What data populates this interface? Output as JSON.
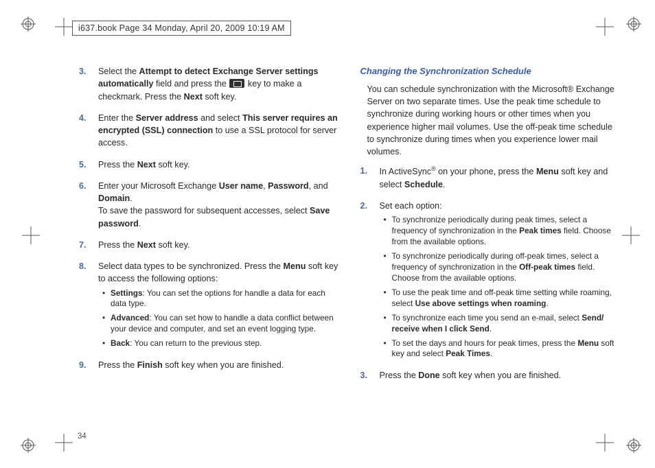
{
  "header": {
    "text": "i637.book  Page 34  Monday, April 20, 2009  10:19 AM"
  },
  "page_number": "34",
  "left_column": {
    "steps": [
      {
        "num": "3.",
        "html": "Select the <b>Attempt to detect Exchange Server settings automatically</b> field and press the {KEY} key to make a checkmark. Press the <b>Next</b> soft key."
      },
      {
        "num": "4.",
        "html": "Enter the <b>Server address</b> and select <b>This server requires an encrypted (SSL) connection</b> to use a SSL protocol for server access."
      },
      {
        "num": "5.",
        "html": "Press the <b>Next</b> soft key."
      },
      {
        "num": "6.",
        "html": "Enter your Microsoft Exchange <b>User name</b>, <b>Password</b>, and <b>Domain</b>.<br>To save the password for subsequent accesses, select <b>Save password</b>."
      },
      {
        "num": "7.",
        "html": "Press the <b>Next</b> soft key."
      },
      {
        "num": "8.",
        "html": "Select data types to be synchronized. Press the <b>Menu</b> soft key to access the following options:",
        "bullets": [
          "<b>Settings</b>: You can set the options for handle a data for each data type.",
          "<b>Advanced</b>: You can set how to handle a data conflict between your device and computer, and set an event logging type.",
          "<b>Back</b>: You can return to the previous step."
        ]
      },
      {
        "num": "9.",
        "html": "Press the <b>Finish</b> soft key when you are finished."
      }
    ]
  },
  "right_column": {
    "heading": "Changing the Synchronization Schedule",
    "intro": "You can schedule synchronization with the Microsoft® Exchange Server on two separate times. Use the peak time schedule to synchronize during working hours or other times when you experience higher mail volumes. Use the off-peak time schedule to synchronize during times when you experience lower mail volumes.",
    "steps": [
      {
        "num": "1.",
        "html": "In ActiveSync<sup>®</sup> on your phone, press the <b>Menu</b> soft key and select <b>Schedule</b>."
      },
      {
        "num": "2.",
        "html": "Set each option:",
        "bullets": [
          "To synchronize periodically during peak times, select a frequency of synchronization in the <b>Peak times</b> field. Choose from the available options.",
          "To synchronize periodically during off-peak times, select a frequency of synchronization in the <b>Off-peak times</b> field. Choose from the available options.",
          "To use the peak time and off-peak time setting while roaming, select <b>Use above settings when roaming</b>.",
          "To synchronize each time you send an e-mail, select <b>Send/ receive when I click Send</b>.",
          "To set the days and hours for peak times, press the <b>Menu</b> soft key and select <b>Peak Times</b>."
        ]
      },
      {
        "num": "3.",
        "html": "Press the <b>Done</b> soft key when you are finished."
      }
    ]
  }
}
